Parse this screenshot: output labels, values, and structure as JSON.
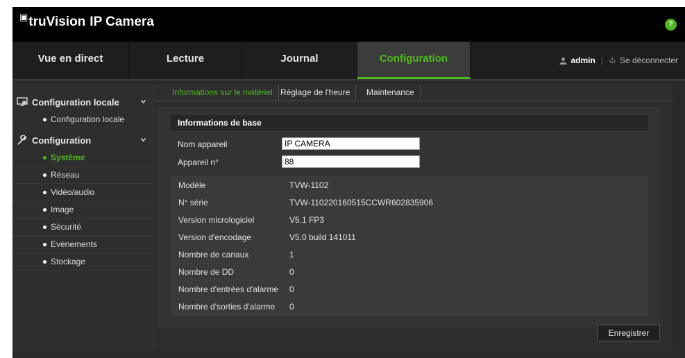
{
  "app": {
    "brand": "truVision",
    "title": "IP Camera",
    "help_label": "?"
  },
  "nav": {
    "tabs": [
      {
        "label": "Vue en direct",
        "active": false
      },
      {
        "label": "Lecture",
        "active": false
      },
      {
        "label": "Journal",
        "active": false
      },
      {
        "label": "Configuration",
        "active": true
      }
    ],
    "user": "admin",
    "separator": "|",
    "logout": "Se déconnecter"
  },
  "sidebar": {
    "sections": [
      {
        "label": "Configuration locale",
        "icon": "local-config-icon",
        "items": [
          {
            "label": "Configuration locale",
            "active": false
          }
        ]
      },
      {
        "label": "Configuration",
        "icon": "wrench-icon",
        "items": [
          {
            "label": "Système",
            "active": true
          },
          {
            "label": "Réseau",
            "active": false
          },
          {
            "label": "Vidéo/audio",
            "active": false
          },
          {
            "label": "Image",
            "active": false
          },
          {
            "label": "Sécurité",
            "active": false
          },
          {
            "label": "Evènements",
            "active": false
          },
          {
            "label": "Stockage",
            "active": false
          }
        ]
      }
    ]
  },
  "subtabs": [
    {
      "label": "Informations sur le matériel",
      "active": true
    },
    {
      "label": "Réglage de l'heure",
      "active": false
    },
    {
      "label": "Maintenance",
      "active": false
    }
  ],
  "basic_info": {
    "header": "Informations de base",
    "device_name_label": "Nom appareil",
    "device_name_value": "IP CAMERA",
    "device_no_label": "Appareil n°",
    "device_no_value": "88"
  },
  "info_rows": [
    {
      "key": "Modèle",
      "value": "TVW-1102"
    },
    {
      "key": "N° série",
      "value": "TVW-110220160515CCWR602835906"
    },
    {
      "key": "Version micrologiciel",
      "value": "V5.1 FP3"
    },
    {
      "key": "Version d'encodage",
      "value": "V5.0 build 141011"
    },
    {
      "key": "Nombre de canaux",
      "value": "1"
    },
    {
      "key": "Nombre de DD",
      "value": "0"
    },
    {
      "key": "Nombre d'entrées d'alarme",
      "value": "0"
    },
    {
      "key": "Nombre d'sorties d'alarme",
      "value": "0"
    }
  ],
  "actions": {
    "save_label": "Enregistrer"
  },
  "colors": {
    "accent": "#4eb81d",
    "background": "#2e2e2e",
    "topbar": "#000000"
  }
}
